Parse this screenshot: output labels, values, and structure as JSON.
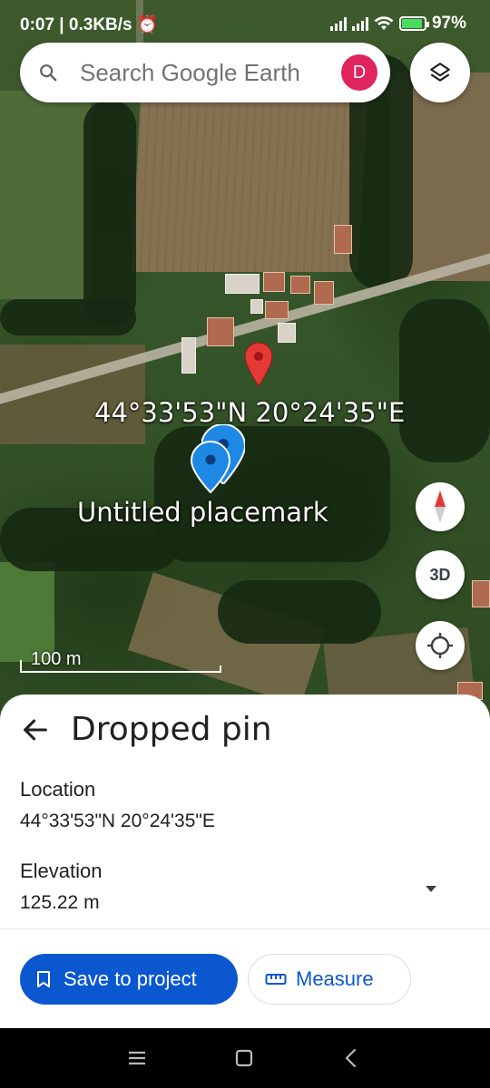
{
  "status_bar": {
    "left_text": "0:07 | 0.3KB/s",
    "battery": "97%"
  },
  "search": {
    "placeholder": "Search Google Earth",
    "avatar_initial": "D"
  },
  "map": {
    "coords_label": "44°33'53\"N 20°24'35\"E",
    "placemark_label": "Untitled placemark",
    "scale_label": "100 m",
    "btn_3d": "3D"
  },
  "sheet": {
    "title": "Dropped pin",
    "location_label": "Location",
    "location_value": "44°33'53\"N 20°24'35\"E",
    "elevation_label": "Elevation",
    "elevation_value": "125.22 m",
    "save_label": "Save to project",
    "measure_label": "Measure"
  },
  "colors": {
    "primary": "#0b57d0",
    "avatar": "#e0245e",
    "pin_red": "#e53935",
    "pin_blue": "#1e88e5"
  },
  "icons": [
    "search-icon",
    "layers-icon",
    "compass-icon",
    "my-location-icon",
    "back-arrow-icon",
    "bookmark-icon",
    "ruler-icon",
    "dropdown-icon",
    "menu-icon",
    "home-icon",
    "nav-back-icon"
  ]
}
